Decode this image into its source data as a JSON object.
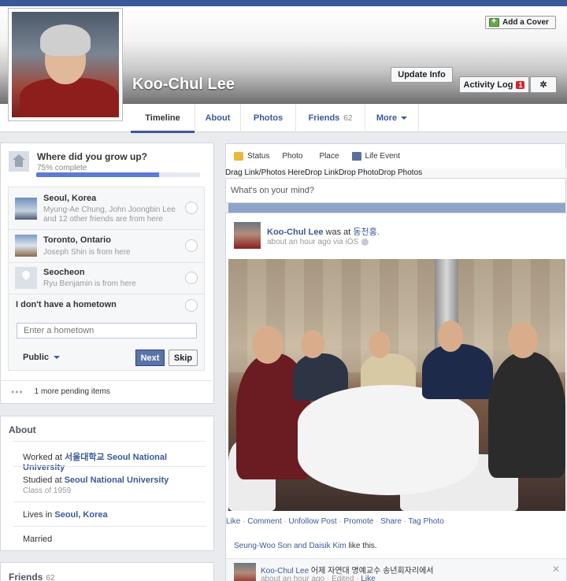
{
  "profile": {
    "name": "Koo-Chul Lee",
    "add_cover": "Add a Cover",
    "update_info": "Update Info",
    "activity_log": "Activity Log",
    "activity_count": "1",
    "gear": "✲"
  },
  "tabs": [
    {
      "label": "Timeline"
    },
    {
      "label": "About"
    },
    {
      "label": "Photos"
    },
    {
      "label": "Friends",
      "count": "62"
    },
    {
      "label": "More"
    }
  ],
  "grow_up": {
    "title": "Where did you grow up?",
    "progress_text": "75% complete",
    "progress": 0.75,
    "places": [
      {
        "name": "Seoul, Korea",
        "desc": "Myung-Ae Chung, John Joongbin Lee and 12 other friends are from here"
      },
      {
        "name": "Toronto, Ontario",
        "desc": "Joseph Shin is from here"
      },
      {
        "name": "Seocheon",
        "desc": "Ryu Benjamin is from here"
      },
      {
        "name": "I don't have a hometown"
      }
    ],
    "input_placeholder": "Enter a hometown",
    "privacy": "Public",
    "next": "Next",
    "skip": "Skip",
    "pending": "1 more pending items"
  },
  "about": {
    "title": "About",
    "rows": [
      {
        "prefix": "Worked at ",
        "link": "서울대학교 Seoul National University"
      },
      {
        "prefix": "Studied at ",
        "link": "Seoul National University",
        "sub": "Class of 1959"
      },
      {
        "prefix": "Lives in ",
        "link": "Seoul, Korea"
      },
      {
        "prefix": "",
        "link": "",
        "plain": "Married"
      }
    ]
  },
  "friends_box": {
    "title": "Friends",
    "count": "62"
  },
  "composer": {
    "tabs": [
      "Status",
      "Photo",
      "Place",
      "Life Event"
    ],
    "drag_text": "Drag Link/Photos HereDrop LinkDrop PhotoDrop Photos",
    "placeholder": "What's on your mind?"
  },
  "post": {
    "author": "Koo-Chul Lee",
    "was_at": " was at ",
    "place": "동천홍.",
    "meta": "about an hour ago via iOS",
    "actions": [
      "Like",
      "Comment",
      "Unfollow Post",
      "Promote",
      "Share",
      "Tag Photo"
    ],
    "likes_names": "Seung-Woo Son and Daisik Kim",
    "likes_suffix": " like this.",
    "comment": {
      "author": "Koo-Chul Lee",
      "text": " 어제 자연대 명예교수 송년회자리에서",
      "meta": "about an hour ago · Edited · ",
      "like": "Like",
      "close": "✕"
    }
  }
}
